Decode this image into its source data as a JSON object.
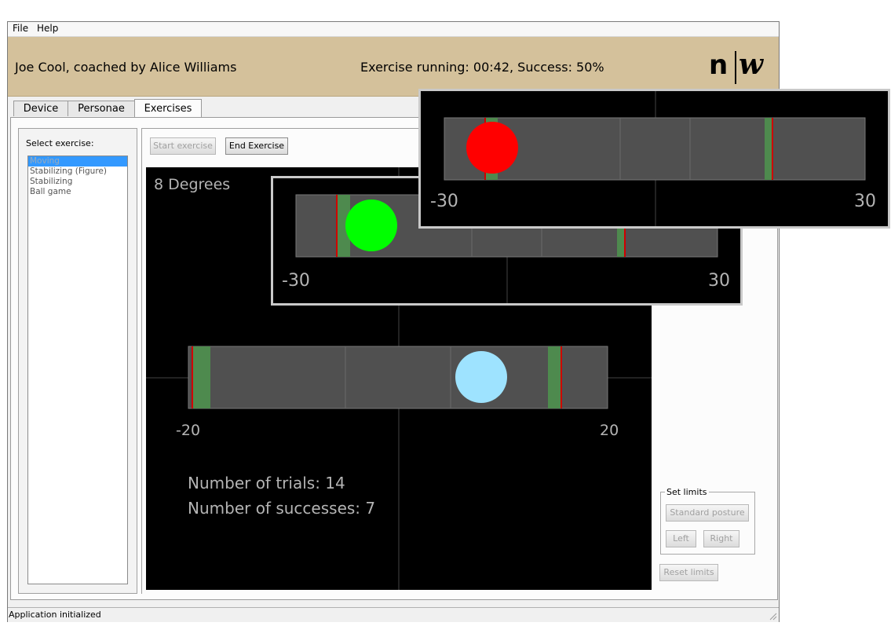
{
  "menu": {
    "file": "File",
    "help": "Help"
  },
  "header": {
    "user": "Joe Cool, coached by Alice Williams",
    "status": "Exercise running: 00:42, Success: 50%",
    "logo_left": "n",
    "logo_right": "w"
  },
  "tabs": [
    {
      "label": "Device",
      "active": false
    },
    {
      "label": "Personae",
      "active": false
    },
    {
      "label": "Exercises",
      "active": true
    }
  ],
  "sidebar": {
    "label": "Select exercise:",
    "items": [
      "Moving",
      "Stabilizing (Figure)",
      "Stabilizing",
      "Ball game"
    ],
    "selected_index": 0
  },
  "toolbar": {
    "start_label": "Start exercise",
    "end_label": "End Exercise"
  },
  "exercise_view": {
    "degrees_label": "8 Degrees",
    "min_label": "-20",
    "max_label": "20",
    "trials_text": "Number of trials: 14",
    "successes_text": "Number of successes: 7",
    "ball_color": "#9ee3ff"
  },
  "popup_green": {
    "min_label": "-30",
    "max_label": "30",
    "ball_color": "#00ff00"
  },
  "popup_red": {
    "min_label": "-30",
    "max_label": "30",
    "ball_color": "#ff0000"
  },
  "limits": {
    "title": "Set limits",
    "standard_label": "Standard posture",
    "left_label": "Left",
    "right_label": "Right",
    "reset_label": "Reset limits"
  },
  "statusbar": {
    "text": "Application initialized"
  },
  "colors": {
    "header_bg": "#d4c19b",
    "track": "#505050",
    "target_zone": "#4e8a4e",
    "limit_line": "#d00000",
    "text_gray": "#b4b4b4"
  }
}
